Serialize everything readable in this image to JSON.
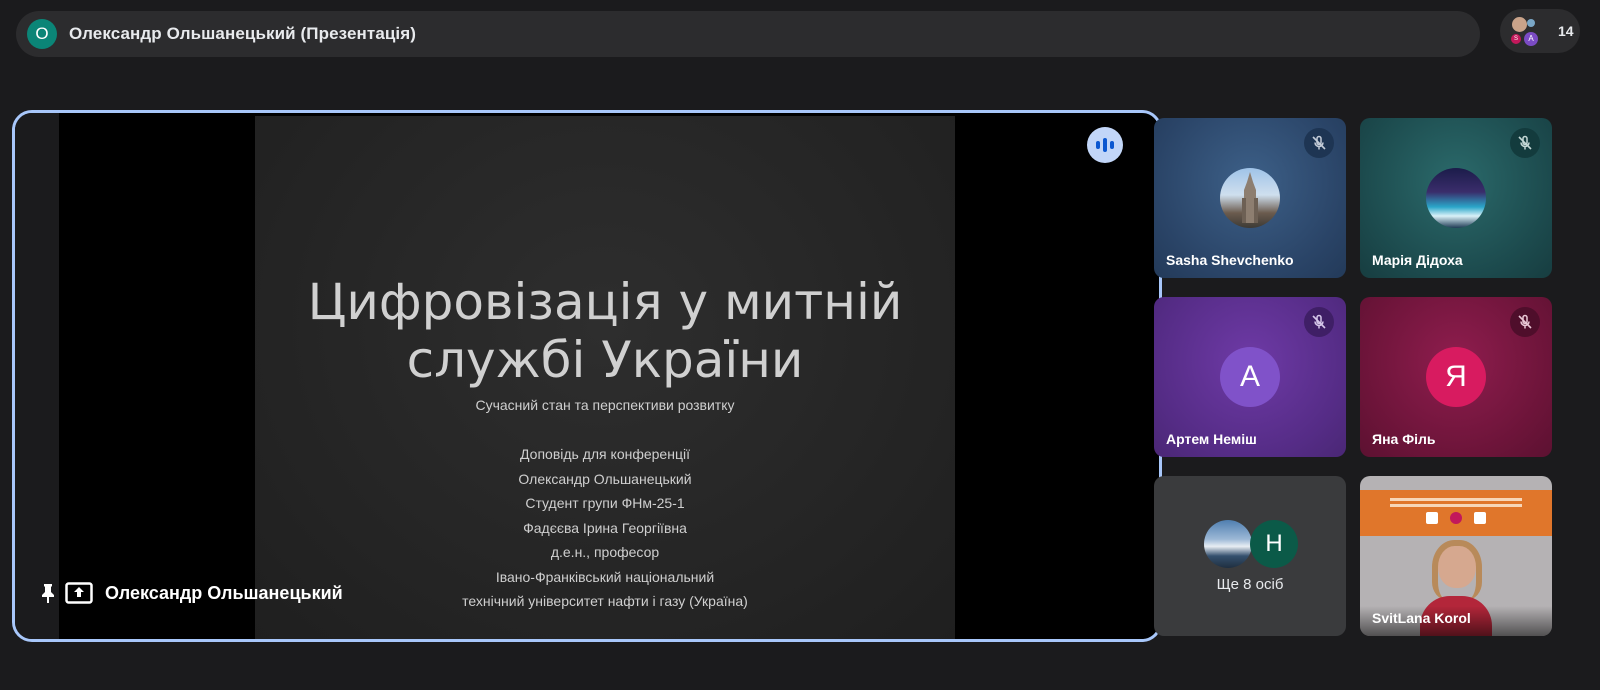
{
  "header": {
    "presenter_initial": "О",
    "title": "Олександр Ольшанецький (Презентація)"
  },
  "participants": {
    "count": "14",
    "mini_avatar_letters": [
      "S",
      "A"
    ]
  },
  "stage": {
    "presenter_name": "Олександр Ольшанецький",
    "slide": {
      "title_line1": "Цифровізація у митній",
      "title_line2": "службі України",
      "subtitle": "Сучасний стан та перспективи розвитку",
      "lines": [
        "Доповідь для конференції",
        "Олександр Ольшанецький",
        "Студент групи ФНм-25-1",
        "Фадєєва Ірина Георгіївна",
        "д.е.н., професор",
        "Івано-Франківський національний",
        "технічний університет нафти і газу (Україна)"
      ]
    }
  },
  "tiles": [
    {
      "name": "Sasha Shevchenko",
      "type": "photo",
      "bg": "#2f4a6e"
    },
    {
      "name": "Марія Дідоха",
      "type": "photo",
      "bg": "#1f4e52"
    },
    {
      "name": "Артем Неміш",
      "type": "letter",
      "letter": "А",
      "bg": "#5b2a8e",
      "avatar_bg": "#7b4bc4"
    },
    {
      "name": "Яна Філь",
      "type": "letter",
      "letter": "Я",
      "bg": "#7a1440",
      "avatar_bg": "#c2185b"
    },
    {
      "more_text": "Ще 8 осіб",
      "letter": "Н"
    },
    {
      "name": "SvitLana Korol",
      "type": "video"
    }
  ],
  "colors": {
    "accent": "#a8c7fa",
    "presenter_avatar": "#0b8577",
    "speaking": "#0b57d0"
  }
}
